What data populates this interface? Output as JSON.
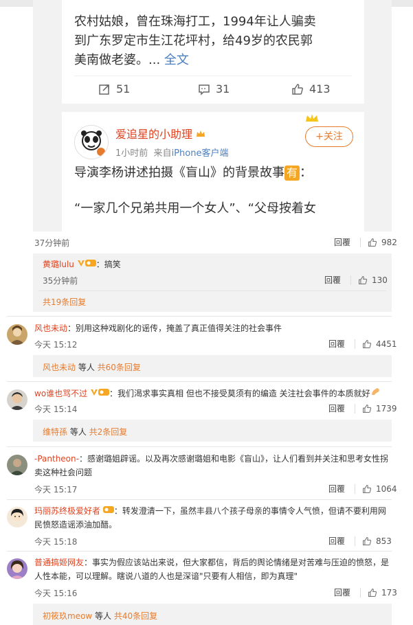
{
  "embed": {
    "lines": [
      "农村姑娘，曾在珠海打工，1994年让人骗卖",
      "到广东罗定市生江花坪村，给49岁的农民郭",
      "美南做老婆。... "
    ],
    "full_text_link": "全文",
    "actions": {
      "repost": "51",
      "comment": "31",
      "like": "413"
    },
    "author": {
      "name": "爱追星的小助理",
      "time": "1小时前",
      "source_prefix": "来自",
      "source": "iPhone客户端",
      "follow": "+关注"
    },
    "post_line1_pre": "导演李杨讲述拍摄《盲山》的背景故事",
    "post_line1_badge": "有",
    "post_line1_post": "：",
    "post_line2": "“一家几个兄弟共用一个女人”、“父母按着女"
  },
  "first_meta": {
    "time": "37分钟前",
    "reply": "回覆",
    "likes": "982"
  },
  "sub_comment": {
    "name": "黄璐lulu",
    "text": "：搞笑",
    "time": "35分钟前",
    "reply": "回覆",
    "likes": "130"
  },
  "sub_reply_count": "共19条回复",
  "comments": [
    {
      "name": "风也未动",
      "text": "：别用这种戏剧化的谣传，掩盖了真正值得关注的社会事件",
      "text2": "",
      "time": "今天 15:12",
      "reply": "回覆",
      "likes": "4451",
      "replies_user": "风也未动",
      "replies_mid": " 等人 ",
      "replies_count": "共60条回复"
    },
    {
      "name": "wo谁也骂不过",
      "text": "：我们渴求事实真相 但也不接受莫须有的编造 关注社会事件的本质就好",
      "text2": "",
      "time": "今天 15:14",
      "reply": "回覆",
      "likes": "1739",
      "replies_user": "维特孫",
      "replies_mid": " 等人 ",
      "replies_count": "共2条回复"
    },
    {
      "name": "-Pantheon-",
      "text": "：感谢璐姐辟谣。以及再次感谢璐姐和电影《盲山》，让人们看到并关注和思考女性拐",
      "text2": "卖这种社会问题",
      "time": "今天 15:17",
      "reply": "回覆",
      "likes": "1064"
    },
    {
      "name": "玛丽苏终极爱好者",
      "text": "：转发澄清一下，虽然丰县八个孩子母亲的事情令人气愤，但请不要利用网",
      "text2": "民愤怒造谣添油加醋。",
      "time": "今天 15:18",
      "reply": "回覆",
      "likes": "853"
    },
    {
      "name": "普通搞姬网友",
      "text": "：事实为假应该站出来说，但大家都信，背后的舆论情绪是对苦难与压迫的愤怒，是",
      "text2": "人性本能，可以理解。瞎说八道的人也是深谙\"只要有人相信，即为真理\"",
      "time": "今天 15:16",
      "reply": "回覆",
      "likes": "173",
      "replies_user": "初筱玖meow",
      "replies_mid": " 等人 ",
      "replies_count": "共40条回复"
    }
  ],
  "colors": {
    "username": "#e0421f",
    "orange": "#e77b2d",
    "link": "#4a7fc1"
  }
}
